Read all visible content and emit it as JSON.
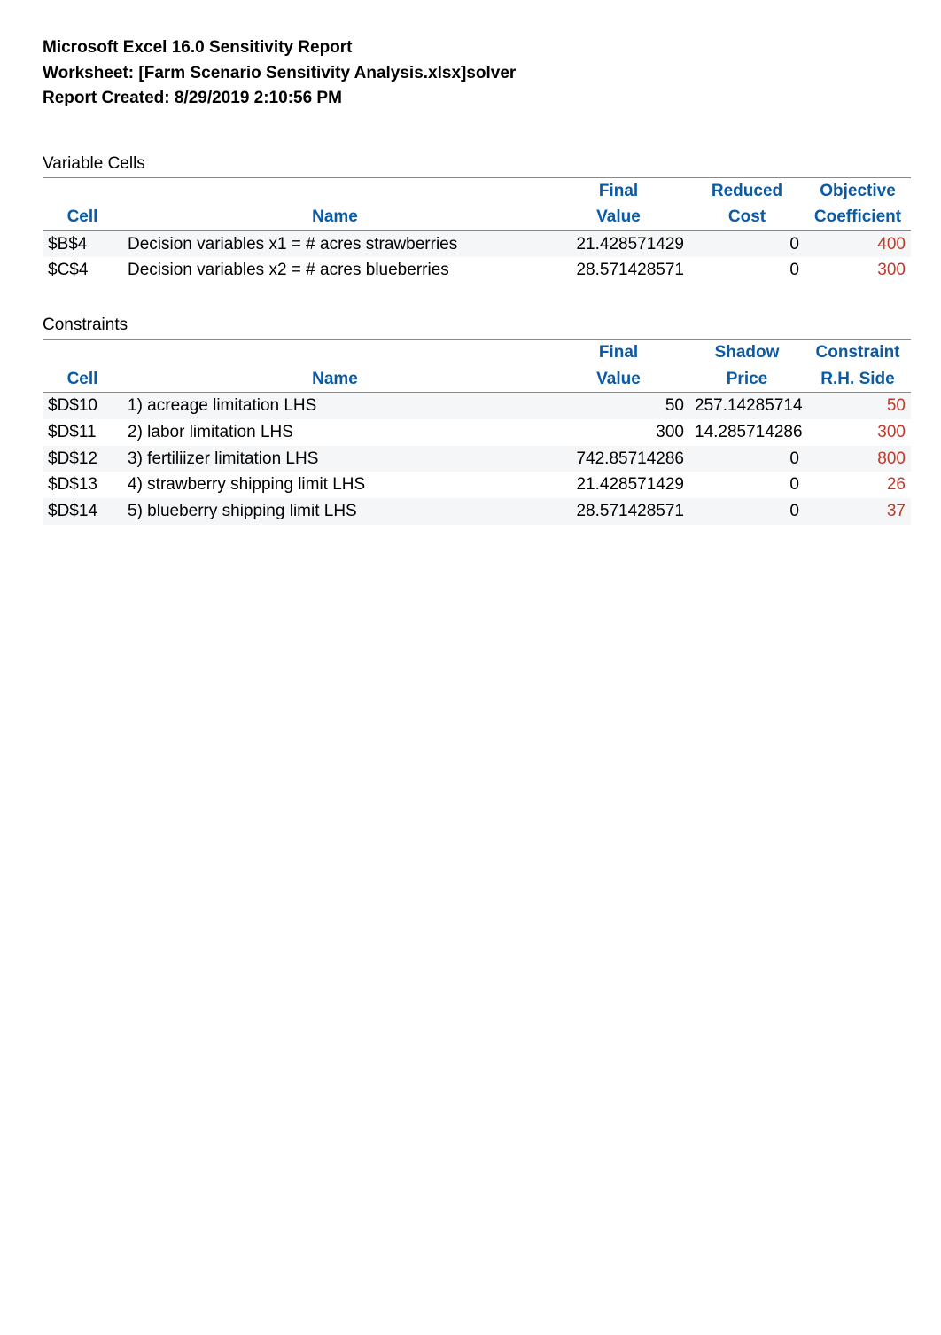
{
  "header": {
    "line1": "Microsoft Excel 16.0 Sensitivity Report",
    "line2": "Worksheet: [Farm Scenario Sensitivity Analysis.xlsx]solver",
    "line3": "Report Created: 8/29/2019 2:10:56 PM"
  },
  "variable_cells": {
    "title": "Variable Cells",
    "group_headers": {
      "c3": "Final",
      "c4": "Reduced",
      "c5": "Objective"
    },
    "headers": {
      "cell": "Cell",
      "name": "Name",
      "c3": "Value",
      "c4": "Cost",
      "c5": "Coefficient"
    },
    "rows": [
      {
        "cell": "$B$4",
        "name": "Decision variables x1 = # acres strawberries",
        "final": "21.428571429",
        "reduced": "0",
        "obj": "400"
      },
      {
        "cell": "$C$4",
        "name": "Decision variables x2 = # acres blueberries",
        "final": "28.571428571",
        "reduced": "0",
        "obj": "300"
      }
    ]
  },
  "constraints": {
    "title": "Constraints",
    "group_headers": {
      "c3": "Final",
      "c4": "Shadow",
      "c5": "Constraint"
    },
    "headers": {
      "cell": "Cell",
      "name": "Name",
      "c3": "Value",
      "c4": "Price",
      "c5": "R.H. Side"
    },
    "rows": [
      {
        "cell": "$D$10",
        "name": "1)  acreage limitation LHS",
        "final": "50",
        "shadow": "257.14285714",
        "rh": "50"
      },
      {
        "cell": "$D$11",
        "name": "2)  labor limitation LHS",
        "final": "300",
        "shadow": "14.285714286",
        "rh": "300"
      },
      {
        "cell": "$D$12",
        "name": "3)  fertiliizer limitation LHS",
        "final": "742.85714286",
        "shadow": "0",
        "rh": "800"
      },
      {
        "cell": "$D$13",
        "name": "4)  strawberry shipping limit LHS",
        "final": "21.428571429",
        "shadow": "0",
        "rh": "26"
      },
      {
        "cell": "$D$14",
        "name": "5)  blueberry shipping limit LHS",
        "final": "28.571428571",
        "shadow": "0",
        "rh": "37"
      }
    ]
  }
}
